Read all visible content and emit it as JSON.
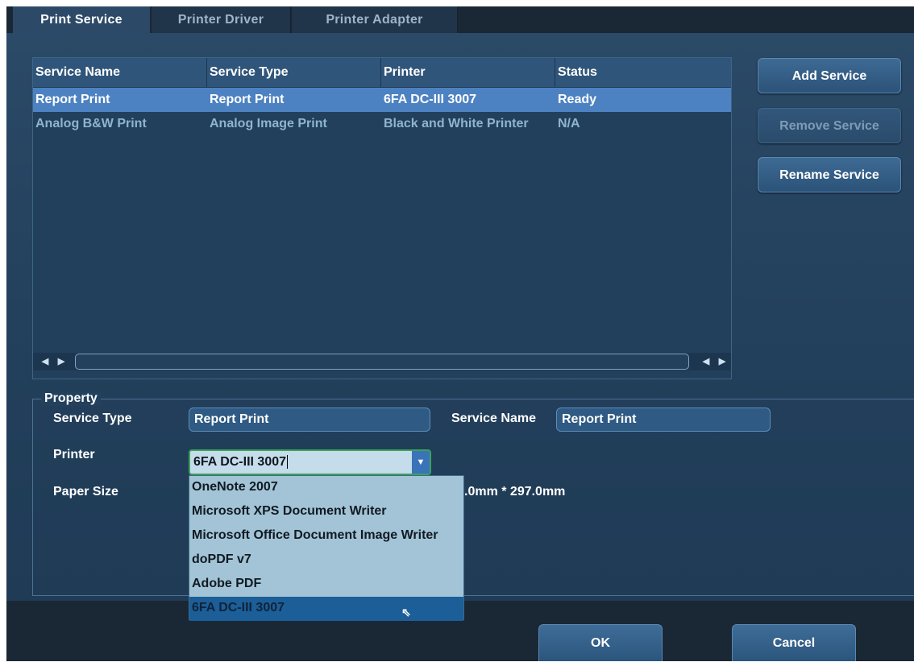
{
  "tabs": [
    "Print Service",
    "Printer Driver",
    "Printer Adapter"
  ],
  "table": {
    "headers": [
      "Service Name",
      "Service Type",
      "Printer",
      "Status"
    ],
    "rows": [
      [
        "Report Print",
        "Report Print",
        "6FA DC-III 3007",
        "Ready"
      ],
      [
        "Analog B&W Print",
        "Analog Image Print",
        "Black and White Printer",
        "N/A"
      ]
    ]
  },
  "side_buttons": {
    "add": "Add Service",
    "remove": "Remove Service",
    "rename": "Rename Service"
  },
  "property": {
    "legend": "Property",
    "service_type_label": "Service Type",
    "service_type_value": "Report Print",
    "service_name_label": "Service Name",
    "service_name_value": "Report Print",
    "printer_label": "Printer",
    "printer_value": "6FA DC-III 3007",
    "paper_size_label": "Paper Size",
    "paper_size_partial": ".0mm * 297.0mm"
  },
  "dropdown_options": [
    "OneNote 2007",
    "Microsoft XPS Document Writer",
    "Microsoft Office Document Image Writer",
    "doPDF v7",
    "Adobe PDF",
    "6FA DC-III 3007"
  ],
  "footer": {
    "ok": "OK",
    "cancel": "Cancel"
  }
}
